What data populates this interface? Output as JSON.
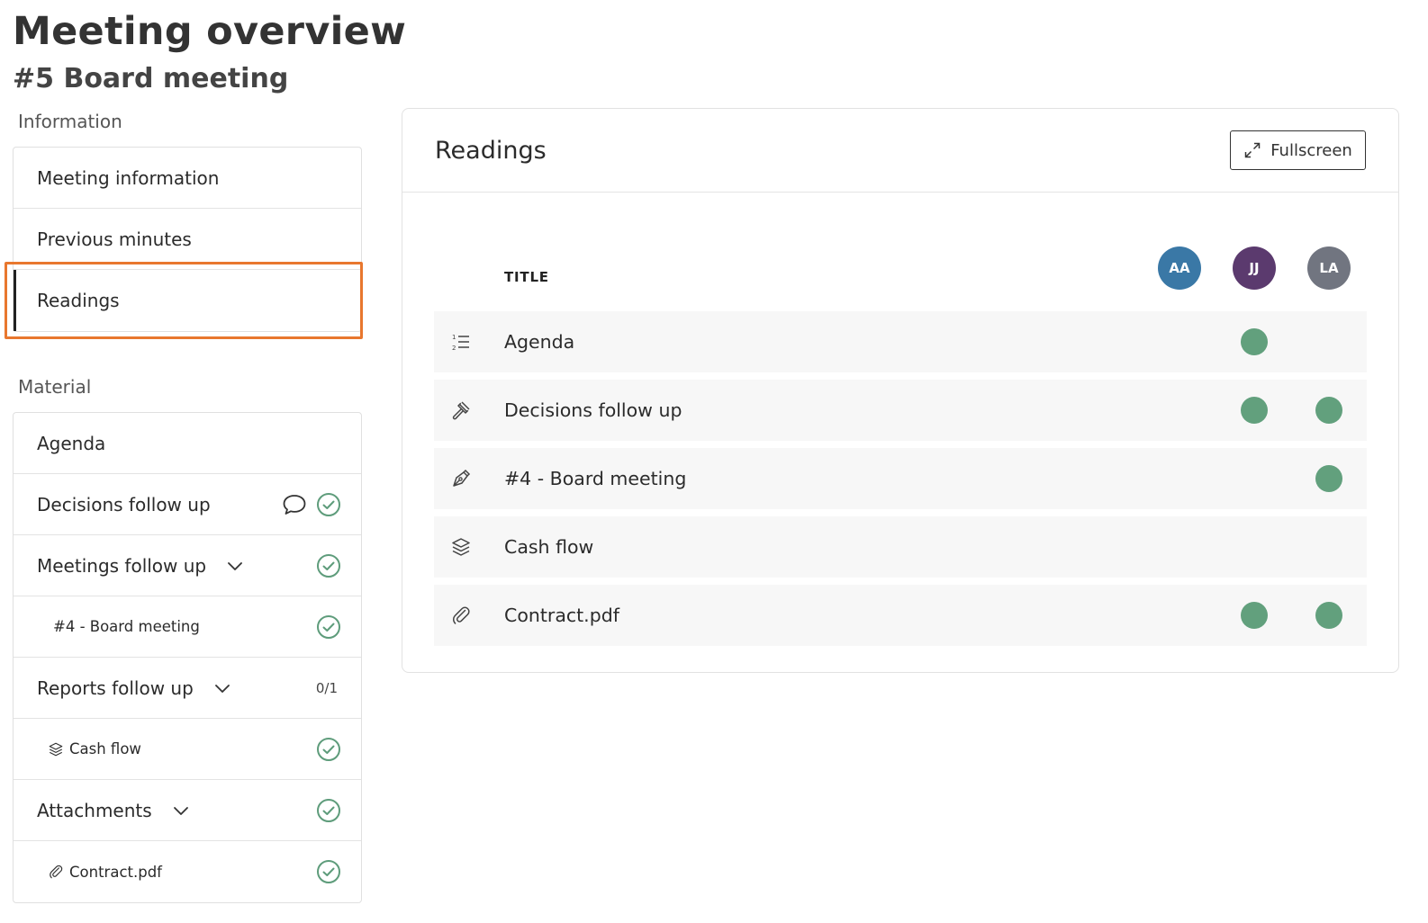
{
  "page": {
    "title": "Meeting overview",
    "meeting_title": "#5 Board meeting"
  },
  "sidebar": {
    "information_label": "Information",
    "information_items": [
      {
        "label": "Meeting information"
      },
      {
        "label": "Previous minutes"
      },
      {
        "label": "Readings",
        "active": true
      }
    ],
    "material_label": "Material",
    "material_items": [
      {
        "label": "Agenda"
      },
      {
        "label": "Decisions follow up",
        "icons": [
          "comment-icon",
          "check-circle-icon"
        ]
      },
      {
        "label": "Meetings follow up",
        "expandable": true,
        "icons": [
          "check-circle-icon"
        ]
      },
      {
        "label": "#4 - Board meeting",
        "sub": true,
        "icons": [
          "check-circle-icon"
        ]
      },
      {
        "label": "Reports follow up",
        "expandable": true,
        "count": "0/1"
      },
      {
        "label": "Cash flow",
        "sub": true,
        "leading_icon": "layers-icon",
        "icons": [
          "check-circle-icon"
        ]
      },
      {
        "label": "Attachments",
        "expandable": true,
        "icons": [
          "check-circle-icon"
        ]
      },
      {
        "label": "Contract.pdf",
        "sub": true,
        "leading_icon": "paperclip-icon",
        "icons": [
          "check-circle-icon"
        ]
      }
    ]
  },
  "readings": {
    "title": "Readings",
    "fullscreen_label": "Fullscreen",
    "column_title": "TITLE",
    "users": [
      {
        "initials": "AA",
        "color": "#3a78a6"
      },
      {
        "initials": "JJ",
        "color": "#5b3a6e"
      },
      {
        "initials": "LA",
        "color": "#717580"
      }
    ],
    "rows": [
      {
        "label": "Agenda",
        "icon": "numbered-list-icon",
        "read_by": [
          false,
          true,
          false
        ]
      },
      {
        "label": "Decisions follow up",
        "icon": "gavel-icon",
        "read_by": [
          false,
          true,
          true
        ]
      },
      {
        "label": "#4 - Board meeting",
        "icon": "pen-nib-icon",
        "read_by": [
          false,
          false,
          true
        ]
      },
      {
        "label": "Cash flow",
        "icon": "layers-icon",
        "read_by": [
          false,
          false,
          false
        ]
      },
      {
        "label": "Contract.pdf",
        "icon": "paperclip-icon",
        "read_by": [
          false,
          true,
          true
        ]
      }
    ]
  },
  "colors": {
    "check_green": "#5e9c7b",
    "read_dot": "#62a07d",
    "highlight": "#e8772e"
  }
}
